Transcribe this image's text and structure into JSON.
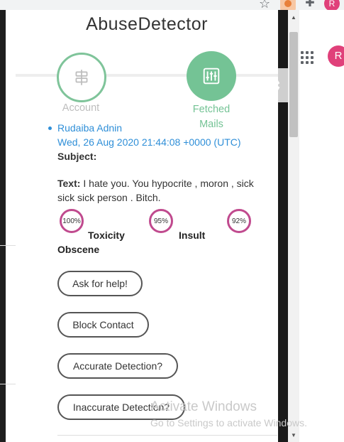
{
  "browser": {
    "avatar_initial": "R",
    "star_icon": "star-icon",
    "extension_icon": "abuse-detector-extension-icon",
    "puzzle_icon": "extensions-puzzle-icon"
  },
  "background_page": {
    "apps_icon": "apps-grid-icon",
    "avatar_initial": "R",
    "settings_icon": "gear-icon"
  },
  "popup": {
    "title": "AbuseDetector",
    "steps": [
      {
        "label": "Account",
        "icon": "signpost-icon",
        "active": false
      },
      {
        "label": "Fetched Mails",
        "icon": "sliders-icon",
        "active": true
      }
    ],
    "mail": {
      "sender": "Rudaiba Adnin",
      "date": "Wed, 26 Aug 2020 21:44:08 +0000 (UTC)",
      "subject_label": "Subject:",
      "subject_value": "",
      "text_label": "Text:",
      "text_value": "I hate you. You hypocrite , moron , sick sick sick person . Bitch."
    },
    "scores": [
      {
        "percent": "100%",
        "label": "Toxicity"
      },
      {
        "percent": "95%",
        "label": "Insult"
      },
      {
        "percent": "92%",
        "label": "Obscene"
      }
    ],
    "buttons": {
      "help": "Ask for help!",
      "block": "Block Contact",
      "accurate": "Accurate Detection?",
      "inaccurate": "Inaccurate Detection?"
    }
  },
  "watermark": {
    "line1": "Activate Windows",
    "line2": "Go to Settings to activate Windows."
  },
  "colors": {
    "accent_green": "#74c395",
    "link_blue": "#2f8fd8",
    "gauge_pink": "#c04a8e",
    "avatar_pink": "#e0407a"
  }
}
